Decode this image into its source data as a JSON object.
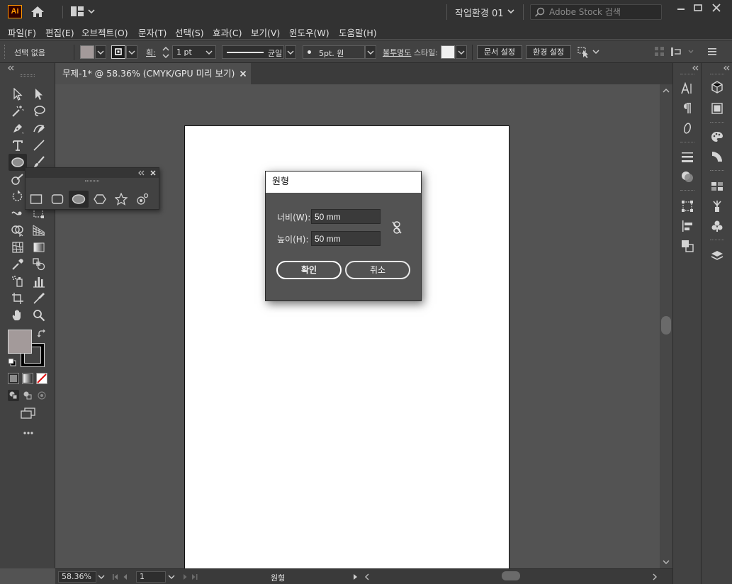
{
  "app": {
    "logo_text": "Ai",
    "workspace": "작업환경 01",
    "stock_search_placeholder": "Adobe Stock 검색"
  },
  "menu": [
    {
      "label": "파일(F)"
    },
    {
      "label": "편집(E)"
    },
    {
      "label": "오브젝트(O)"
    },
    {
      "label": "문자(T)"
    },
    {
      "label": "선택(S)"
    },
    {
      "label": "효과(C)"
    },
    {
      "label": "보기(V)"
    },
    {
      "label": "윈도우(W)"
    },
    {
      "label": "도움말(H)"
    }
  ],
  "control": {
    "selection_state": "선택 없음",
    "stroke_label": "획:",
    "stroke_weight": "1 pt",
    "stroke_profile": "균일",
    "brush": "5pt. 원",
    "opacity_label": "불투명도",
    "style_label": "스타일:",
    "doc_setup": "문서 설정",
    "preferences": "환경 설정",
    "fill_color": "#a39a9a"
  },
  "document": {
    "tab_title": "무제-1* @ 58.36% (CMYK/GPU 미리 보기)",
    "zoom": "58.36%",
    "artboard_number": "1",
    "status_tool": "원형"
  },
  "dialog": {
    "title": "원형",
    "width_label": "너비(W):",
    "width_value": "50 mm",
    "height_label": "높이(H):",
    "height_value": "50 mm",
    "ok": "확인",
    "cancel": "취소"
  },
  "toolbar": {
    "fill_color": "#a39a9a",
    "stroke_color": "#000000"
  }
}
